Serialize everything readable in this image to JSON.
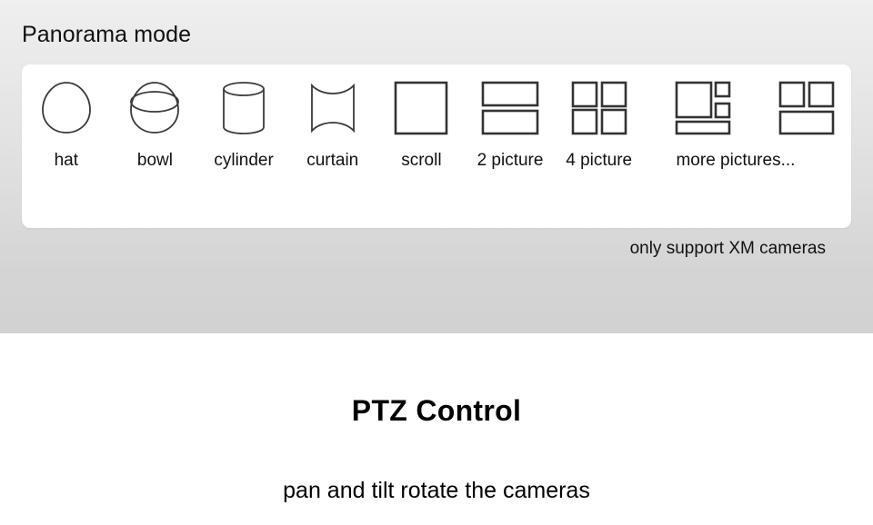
{
  "panorama": {
    "title": "Panorama mode",
    "support_note": "only support XM cameras",
    "modes": [
      {
        "icon": "hat-icon",
        "label": "hat"
      },
      {
        "icon": "bowl-icon",
        "label": "bowl"
      },
      {
        "icon": "cylinder-icon",
        "label": "cylinder"
      },
      {
        "icon": "curtain-icon",
        "label": "curtain"
      },
      {
        "icon": "scroll-icon",
        "label": "scroll"
      },
      {
        "icon": "two-picture-icon",
        "label": "2 picture"
      },
      {
        "icon": "four-picture-icon",
        "label": "4 picture"
      },
      {
        "icon": "more-pictures-a-icon",
        "label": "more pictures..."
      },
      {
        "icon": "more-pictures-b-icon",
        "label": ""
      }
    ]
  },
  "ptz": {
    "title": "PTZ Control",
    "subtitle": "pan and tilt rotate the cameras"
  },
  "colors": {
    "panel_top": "#efefef",
    "panel_bottom": "#d2d2d2",
    "card": "#ffffff",
    "stroke_thin": "#3a3a3a",
    "stroke_thick": "#333333",
    "text": "#111111"
  }
}
